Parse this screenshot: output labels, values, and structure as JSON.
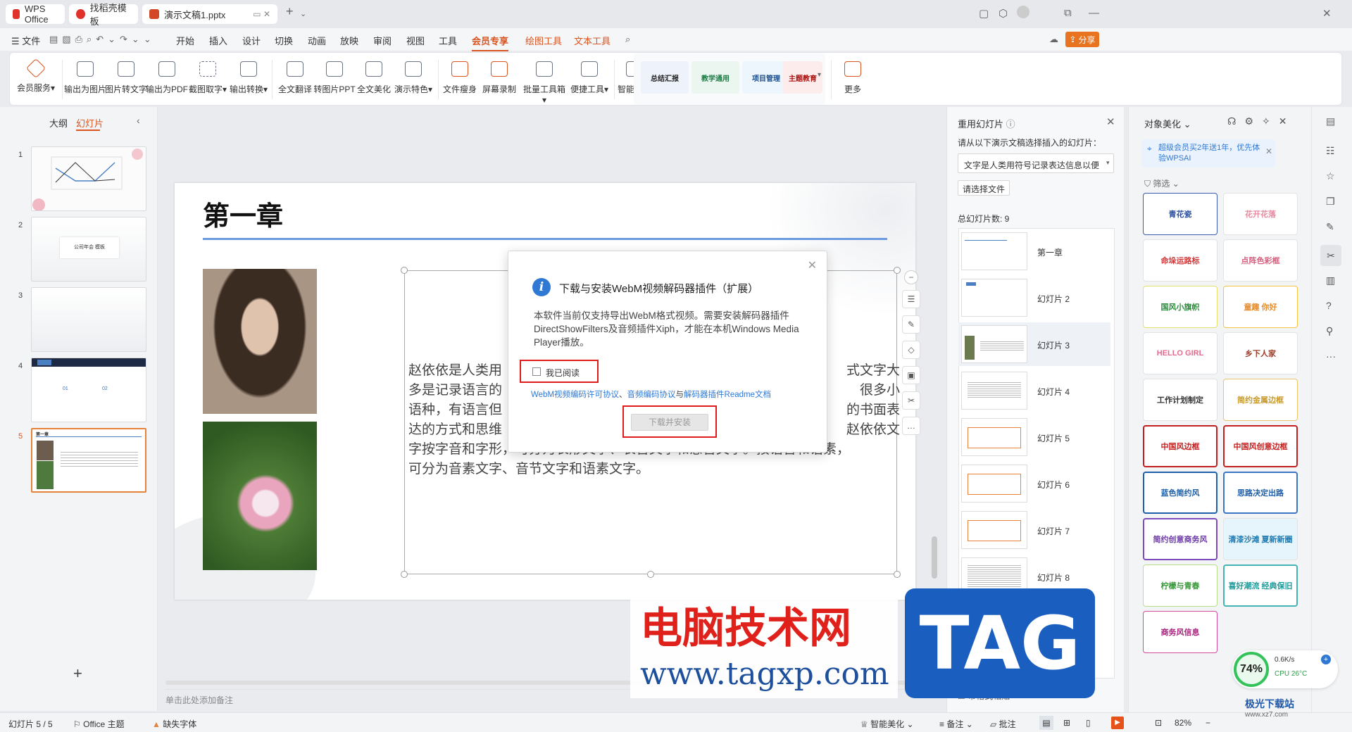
{
  "tabs": [
    {
      "label": "WPS Office",
      "icon": "wps-logo-icon"
    },
    {
      "label": "找稻壳模板",
      "icon": "docer-icon"
    },
    {
      "label": "演示文稿1.pptx",
      "icon": "ppt-icon"
    }
  ],
  "menu": {
    "file": "文件",
    "items": [
      "开始",
      "插入",
      "设计",
      "切换",
      "动画",
      "放映",
      "审阅",
      "视图",
      "工具",
      "会员专享",
      "绘图工具",
      "文本工具"
    ],
    "share": "分享"
  },
  "ribbon": {
    "buttons": [
      "会员服务",
      "输出为图片",
      "图片转文字",
      "输出为PDF",
      "截图取字",
      "输出转换",
      "全文翻译",
      "转图片PPT",
      "全文美化",
      "演示特色",
      "文件瘦身",
      "屏幕录制",
      "批量工具箱",
      "便捷工具",
      "智能模板"
    ],
    "templates": [
      "总结汇报",
      "教学通用",
      "项目管理",
      "主题教育"
    ],
    "more": "更多"
  },
  "left_panel": {
    "tab_outline": "大纲",
    "tab_slides": "幻灯片",
    "slide_numbers": [
      "1",
      "2",
      "3",
      "4",
      "5"
    ],
    "thumb2_text": "公司年会 模板",
    "thumb4_labels": [
      "01",
      "02"
    ],
    "thumb5_title": "第一章"
  },
  "slide": {
    "title": "第一章",
    "body_visible": [
      "赵依依是人类用",
      "多是记录语言的",
      "语种，有语言但",
      "达的方式和思维",
      "字按字音和字形，可分为表形文字、表音文字和意音文字。按语音和语素，",
      "可分为音素文字、音节文字和语素文字。"
    ],
    "body_right": [
      "式文字大",
      "很多小",
      "的书面表",
      "赵依依文"
    ]
  },
  "notes_placeholder": "单击此处添加备注",
  "dialog": {
    "title": "下载与安装WebM视频解码器插件（扩展）",
    "body": "本软件当前仅支持导出WebM格式视频。需要安装解码器插件DirectShowFilters及音频插件Xiph，才能在本机Windows Media Player播放。",
    "checkbox_label": "我已阅读",
    "link1": "WebM视频编码许可协议",
    "sep1": "、",
    "link2": "音频编码协议",
    "sep2": "与",
    "link3": "解码器插件Readme文档",
    "button": "下载并安装"
  },
  "reuse_panel": {
    "title": "重用幻灯片",
    "instruction": "请从以下演示文稿选择插入的幻灯片：",
    "dropdown_value": "文字是人类用符号记录表达信息以便",
    "choose_file": "请选择文件",
    "total": "总幻灯片数: 9",
    "slides": [
      "第一章",
      "幻灯片 2",
      "幻灯片 3",
      "幻灯片 4",
      "幻灯片 5",
      "幻灯片 6",
      "幻灯片 7",
      "幻灯片 8"
    ],
    "keep_format": "带格式粘贴"
  },
  "beauty_panel": {
    "title": "对象美化",
    "promo": "超级会员买2年送1年，优先体验WPSAI",
    "filter": "筛选",
    "tiles": [
      "青花瓷",
      "花开花落",
      "命垛运路标",
      "点阵色彩框",
      "国风小旗帜",
      "童趣 你好",
      "HELLO GIRL",
      "乡下人家",
      "工作计划制定",
      "简约金属边框",
      "中国风边框",
      "中国风创意边框",
      "蓝色简约风",
      "思路决定出路",
      "简约创意商务风",
      "清漆沙滩 夏新新圈",
      "柠檬与青春",
      "喜好潮流 经典保旧",
      "商务风信息"
    ]
  },
  "status": {
    "slide_counter": "幻灯片 5 / 5",
    "theme": "Office 主题",
    "missing_font": "缺失字体",
    "smart_beauty": "智能美化",
    "notes": "备注",
    "comment": "批注",
    "zoom": "82%"
  },
  "perf_widget": {
    "percent": "74%",
    "speed": "0.6K/s",
    "cpu": "CPU 26°C"
  },
  "watermark": {
    "cn": "电脑技术网",
    "url": "www.tagxp.com",
    "tag": "TAG",
    "brand": "极光下载站",
    "brand_url": "www.xz7.com"
  }
}
